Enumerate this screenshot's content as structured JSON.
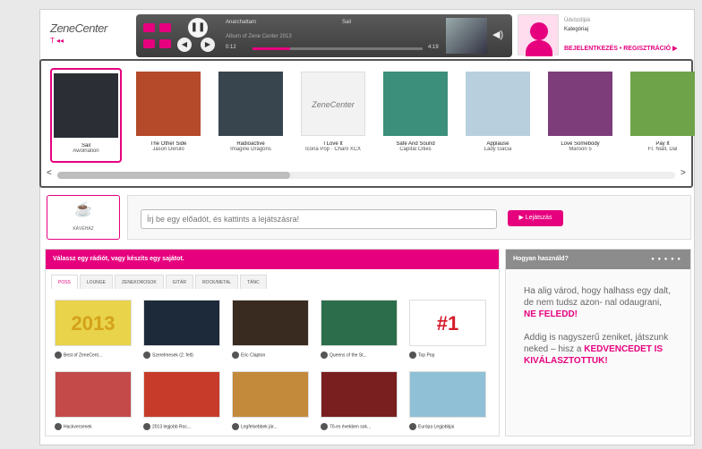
{
  "logo": {
    "brand": "ZeneCenter",
    "sub": "T ◂◂"
  },
  "player": {
    "track_title": "Anarchattam",
    "track_artist": "Sail",
    "track_album": "Album of Zene Center 2013",
    "time_current": "0:12",
    "time_total": "4:19",
    "progress": 0.22
  },
  "user": {
    "greeting": "Üdvözöljük",
    "name": "Kategóriaj",
    "login_link": "BEJELENTKEZÉS • REGISZTRÁCIÓ ▶"
  },
  "carousel": {
    "albums": [
      {
        "title": "Sail",
        "artist": "Awolnation",
        "color": "#2b2f35",
        "selected": true
      },
      {
        "title": "The Other Side",
        "artist": "Jason Derulo",
        "color": "#b44a2a"
      },
      {
        "title": "Radioactive",
        "artist": "Imagine Dragons",
        "color": "#38454f"
      },
      {
        "title": "I Love It",
        "artist": "Icona Pop · Charli XCX",
        "color": "#f2f2f2",
        "logo": "ZeneCenter"
      },
      {
        "title": "Safe And Sound",
        "artist": "Capital Cities",
        "color": "#3c8f7b"
      },
      {
        "title": "Applause",
        "artist": "Lady GaGa",
        "color": "#b8d0dd"
      },
      {
        "title": "Love Somebody",
        "artist": "Maroon 5",
        "color": "#7c3d7a"
      },
      {
        "title": "Pay It",
        "artist": "Ft. Niall, Dal",
        "color": "#6fa34a"
      }
    ],
    "prev": "<",
    "next": ">"
  },
  "mood": {
    "label": "KÁVÉHÁZ"
  },
  "search": {
    "placeholder": "Írj be egy előadót, és kattints a lejátszásra!",
    "button": "▶ Lejátszás"
  },
  "panel": {
    "heading": "Válassz egy rádiót, vagy készíts egy sajátot.",
    "tabs": [
      "POSS",
      "LOUNGE",
      "ZENEKOROSOK",
      "GITÁR",
      "ROCK/METAL",
      "TÁNC"
    ],
    "tiles": [
      {
        "caption": "Best of ZeneCent...",
        "color": "#e8d34a",
        "text": "2013"
      },
      {
        "caption": "Szerelmesek (2. felt)",
        "color": "#1d2a3a"
      },
      {
        "caption": "Eric Clapton",
        "color": "#3a2b20"
      },
      {
        "caption": "Queens of the St...",
        "color": "#2c6e4b"
      },
      {
        "caption": "Top Pop",
        "color": "#ffffff",
        "text": "#1"
      },
      {
        "caption": "Hackversenek",
        "color": "#c44a4a"
      },
      {
        "caption": "2013 legjobb Roc...",
        "color": "#c73b2a"
      },
      {
        "caption": "Legfelsebbek jár...",
        "color": "#c28a3a"
      },
      {
        "caption": "70-es években sok...",
        "color": "#7a1f1f"
      },
      {
        "caption": "Európa Legjobbjai",
        "color": "#8fc0d6"
      }
    ]
  },
  "side": {
    "heading": "Hogyan használd?",
    "dots": "● ● ● ● ●",
    "text1": "Ha alig várod, hogy halhass egy dalt, de nem tudsz azon- nal odaugrani,",
    "highlight1": "NE FELEDD!",
    "text2": "Addig is nagyszerű zeniket, játszunk neked – hisz a",
    "highlight2": "KEDVENCEDET IS KIVÁLASZTOTTUK!"
  }
}
